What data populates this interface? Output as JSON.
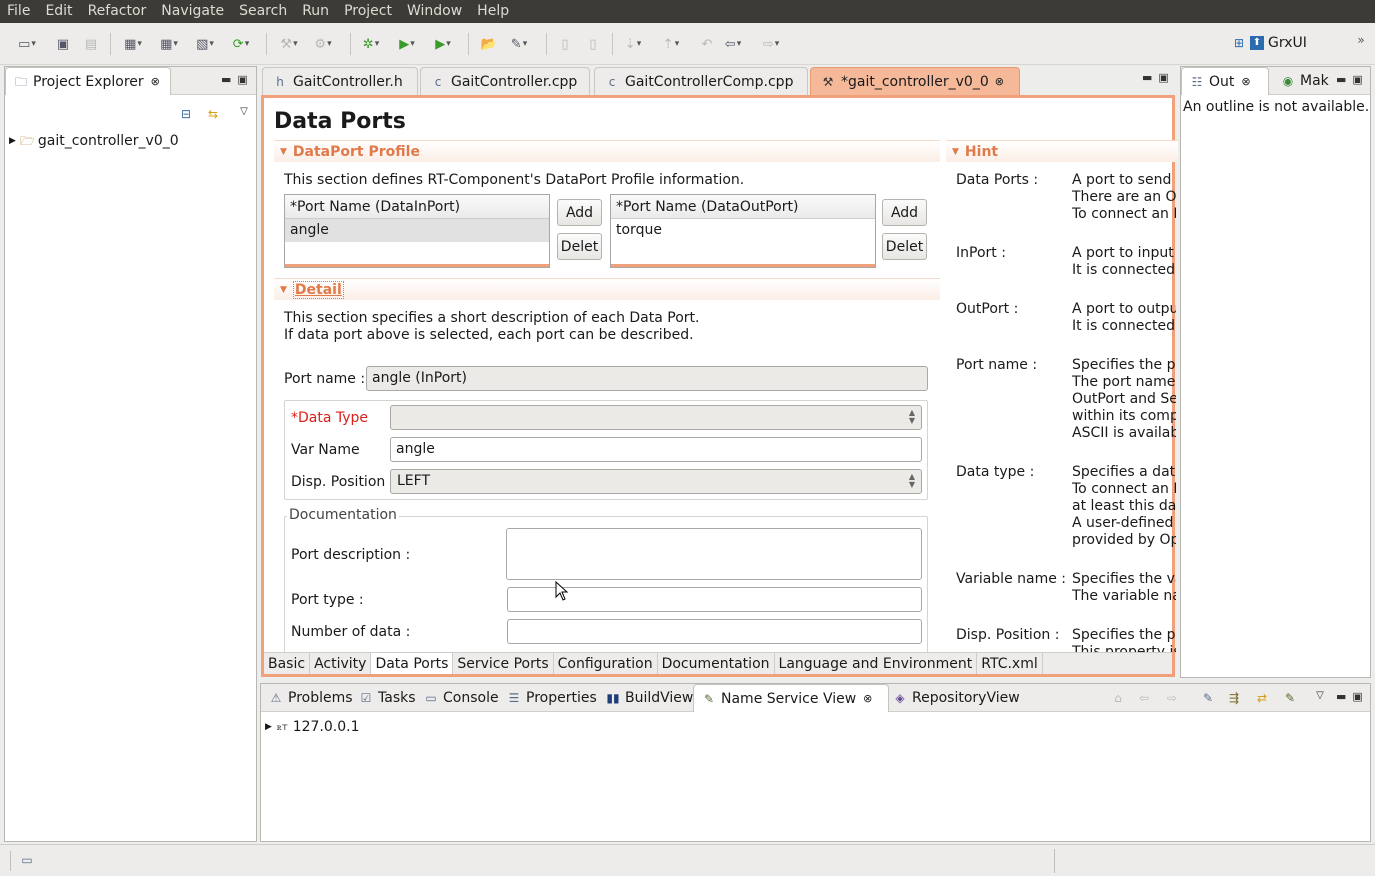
{
  "menu": [
    "File",
    "Edit",
    "Refactor",
    "Navigate",
    "Search",
    "Run",
    "Project",
    "Window",
    "Help"
  ],
  "perspective": "GrxUI",
  "project_explorer": {
    "title": "Project Explorer",
    "tree": [
      "gait_controller_v0_0"
    ]
  },
  "editor_tabs": [
    "GaitController.h",
    "GaitController.cpp",
    "GaitControllerComp.cpp",
    "*gait_controller_v0_0"
  ],
  "page_title": "Data Ports",
  "dataport_profile": {
    "heading": "DataPort Profile",
    "description": "This section defines RT-Component's DataPort Profile information.",
    "inport_header": "*Port Name (DataInPort)",
    "inports": [
      "angle"
    ],
    "outport_header": "*Port Name (DataOutPort)",
    "outports": [
      "torque"
    ],
    "add_label": "Add",
    "delete_label": "Delet"
  },
  "detail": {
    "heading": "Detail",
    "desc1": "This section specifies a short description of each Data Port.",
    "desc2": "If data port above is selected, each port can be described.",
    "port_name_label": "Port name :",
    "port_name_value": "angle (InPort)",
    "data_type_label": "*Data Type",
    "data_type_value": "",
    "var_name_label": "Var Name",
    "var_name_value": "angle",
    "disp_position_label": "Disp. Position",
    "disp_position_value": "LEFT",
    "documentation_legend": "Documentation",
    "port_description_label": "Port description :",
    "port_type_label": "Port type :",
    "number_of_data_label": "Number of data :"
  },
  "hint": {
    "heading": "Hint",
    "items": [
      {
        "label": "Data Ports :",
        "lines": [
          "A port to send",
          "There are an Ou",
          "To connect an I"
        ]
      },
      {
        "label": "InPort :",
        "lines": [
          "A port to input",
          "It is connected"
        ]
      },
      {
        "label": "OutPort :",
        "lines": [
          "A port to outpu",
          "It is connected"
        ]
      },
      {
        "label": "Port name :",
        "lines": [
          "Specifies the po",
          "The port name",
          "OutPort and Se",
          "within its comp",
          "ASCII is availab"
        ]
      },
      {
        "label": "Data type :",
        "lines": [
          "Specifies a data",
          "To connect an I",
          "at least this dat",
          "A user-defined I",
          "provided by Op"
        ]
      },
      {
        "label": "Variable name :",
        "lines": [
          "Specifies the va",
          "The variable nar"
        ]
      },
      {
        "label": "Disp. Position :",
        "lines": [
          "Specifies the po",
          "This property is"
        ]
      }
    ]
  },
  "editor_bottom_tabs": [
    "Basic",
    "Activity",
    "Data Ports",
    "Service Ports",
    "Configuration",
    "Documentation",
    "Language and Environment",
    "RTC.xml"
  ],
  "outline": {
    "tabs": [
      "Out",
      "Mak"
    ],
    "message": "An outline is not available."
  },
  "bottom_views": {
    "tabs": [
      "Problems",
      "Tasks",
      "Console",
      "Properties",
      "BuildView",
      "Name Service View",
      "RepositoryView"
    ],
    "tree_prefix": "ꭱᴛ",
    "tree_item": "127.0.0.1"
  }
}
